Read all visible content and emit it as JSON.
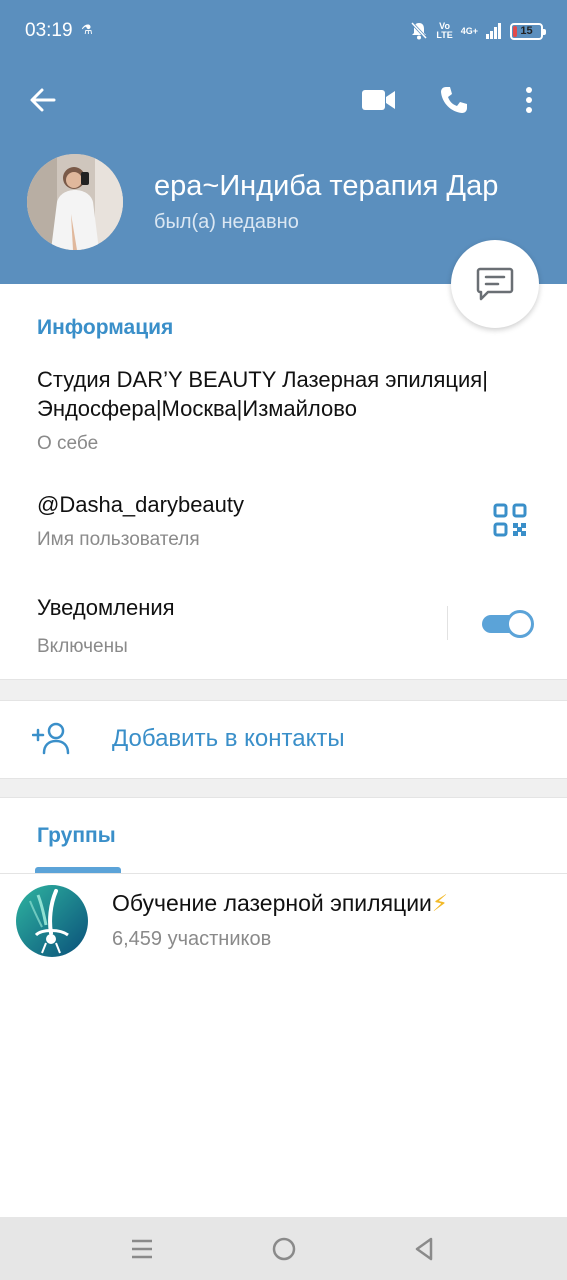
{
  "status_bar": {
    "time": "03:19",
    "network_lte": "Vo\nLTE",
    "network_4g": "4G+",
    "battery_level": "15",
    "battery_fraction": 0.15
  },
  "header": {
    "background_color": "#5b8fbe",
    "profile_name": "ера~Индиба терапия   Дар",
    "profile_status": "был(а) недавно"
  },
  "info": {
    "section_title": "Информация",
    "about_text": "Студия DAR’Y BEAUTY Лазерная эпиляция|Эндосфера|Москва|Измайлово",
    "about_label": "О себе",
    "username": "@Dasha_darybeauty",
    "username_label": "Имя пользователя",
    "notifications_title": "Уведомления",
    "notifications_state": "Включены",
    "notifications_on": true
  },
  "actions": {
    "add_contact_label": "Добавить в контакты"
  },
  "tabs": {
    "groups_label": "Группы"
  },
  "groups": [
    {
      "name": "Обучение лазерной эпиляции",
      "emoji": "⚡",
      "members": "6,459 участников"
    }
  ],
  "icons": {
    "back": "arrow-left-icon",
    "video": "video-camera-icon",
    "call": "phone-icon",
    "menu": "more-vertical-icon",
    "message": "message-icon",
    "qr": "qr-code-icon",
    "add_contact": "add-person-icon"
  },
  "colors": {
    "accent": "#3a8fc9",
    "toggle": "#5ba3d8"
  }
}
